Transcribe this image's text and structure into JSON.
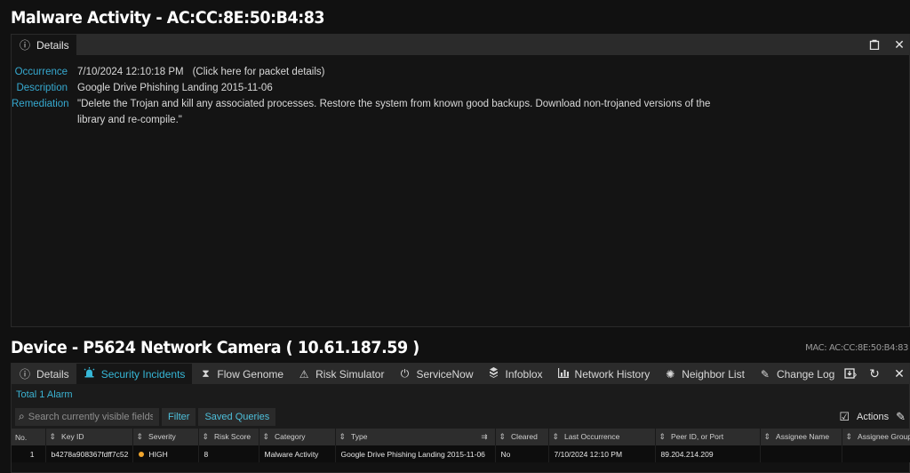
{
  "header": {
    "title": "Malware Activity - AC:CC:8E:50:B4:83"
  },
  "details_panel": {
    "tab_label": "Details",
    "occurrence_label": "Occurrence",
    "occurrence_value": "7/10/2024 12:10:18 PM",
    "packet_link": "(Click here for packet details)",
    "description_label": "Description",
    "description_value": "Google Drive Phishing Landing 2015-11-06",
    "remediation_label": "Remediation",
    "remediation_value": "\"Delete the Trojan and kill any associated processes. Restore the system from known good backups. Download non-trojaned versions of the library and re-compile.\""
  },
  "device": {
    "title": "Device - P5624 Network Camera ( 10.61.187.59 )",
    "mac": "MAC: AC:CC:8E:50:B4:83",
    "tabs": [
      {
        "label": "Details",
        "icon": "info-icon"
      },
      {
        "label": "Security Incidents",
        "icon": "alarm-icon"
      },
      {
        "label": "Flow Genome",
        "icon": "hourglass-icon"
      },
      {
        "label": "Risk Simulator",
        "icon": "warning-icon"
      },
      {
        "label": "ServiceNow",
        "icon": "power-icon"
      },
      {
        "label": "Infoblox",
        "icon": "infoblox-icon"
      },
      {
        "label": "Network History",
        "icon": "bar-chart-icon"
      },
      {
        "label": "Neighbor List",
        "icon": "network-icon"
      },
      {
        "label": "Change Log",
        "icon": "edit-icon"
      }
    ],
    "total_text": "Total 1 Alarm",
    "search_placeholder": "Search currently visible fields ...",
    "filter_label": "Filter",
    "saved_queries_label": "Saved Queries",
    "actions_label": "Actions",
    "columns": [
      "No.",
      "Key ID",
      "Severity",
      "Risk Score",
      "Category",
      "Type",
      "Cleared",
      "Last Occurrence",
      "Peer ID, or Port",
      "Assignee Name",
      "Assignee Group"
    ],
    "rows": [
      {
        "no": "1",
        "key_id": "b4278a908367fdff7c52",
        "severity": "HIGH",
        "risk_score": "8",
        "category": "Malware Activity",
        "type": "Google Drive Phishing Landing 2015-11-06",
        "cleared": "No",
        "last_occurrence": "7/10/2024 12:10 PM",
        "peer": "89.204.214.209",
        "assignee_name": "",
        "assignee_group": ""
      }
    ]
  },
  "colors": {
    "accent": "#36b7d7",
    "severity_high": "#f2a62d",
    "background": "#111111"
  }
}
